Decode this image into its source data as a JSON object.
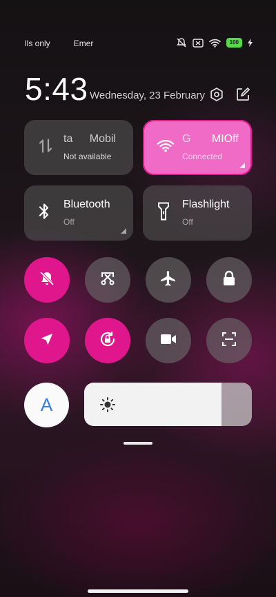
{
  "status_bar": {
    "left_texts": [
      "lls only",
      "Emer"
    ],
    "battery": "100",
    "icons": [
      "mute-vibrate-icon",
      "no-sim-icon",
      "wifi-icon",
      "battery-icon",
      "charging-icon"
    ]
  },
  "header": {
    "time": "5:43",
    "date": "Wednesday, 23 February"
  },
  "tiles": {
    "mobile_data": {
      "title_a": "ta",
      "title_b": "Mobil",
      "status": "Not available",
      "icon": "mobile-data-icon"
    },
    "wifi": {
      "title_a": "G",
      "title_b": "MIOff",
      "status": "Connected",
      "icon": "wifi-icon",
      "active": true
    },
    "bluetooth": {
      "title": "Bluetooth",
      "status": "Off",
      "icon": "bluetooth-icon"
    },
    "flashlight": {
      "title": "Flashlight",
      "status": "Off",
      "icon": "flashlight-icon"
    }
  },
  "toggles_row1": [
    {
      "name": "mute",
      "icon": "bell-off-icon",
      "active": true
    },
    {
      "name": "screenshot",
      "icon": "scissors-icon",
      "active": false
    },
    {
      "name": "airplane",
      "icon": "airplane-icon",
      "active": false
    },
    {
      "name": "lock",
      "icon": "lock-icon",
      "active": false
    }
  ],
  "toggles_row2": [
    {
      "name": "location",
      "icon": "location-arrow-icon",
      "active": true
    },
    {
      "name": "auto-rotate",
      "icon": "rotate-lock-icon",
      "active": true
    },
    {
      "name": "screen-record",
      "icon": "video-camera-icon",
      "active": false
    },
    {
      "name": "scanner",
      "icon": "scan-icon",
      "active": false
    }
  ],
  "brightness": {
    "auto_label": "A",
    "level": 0.82
  },
  "colors": {
    "accent": "#e0168d",
    "wifi_tile": "#f06bc6",
    "battery": "#57d94a"
  }
}
